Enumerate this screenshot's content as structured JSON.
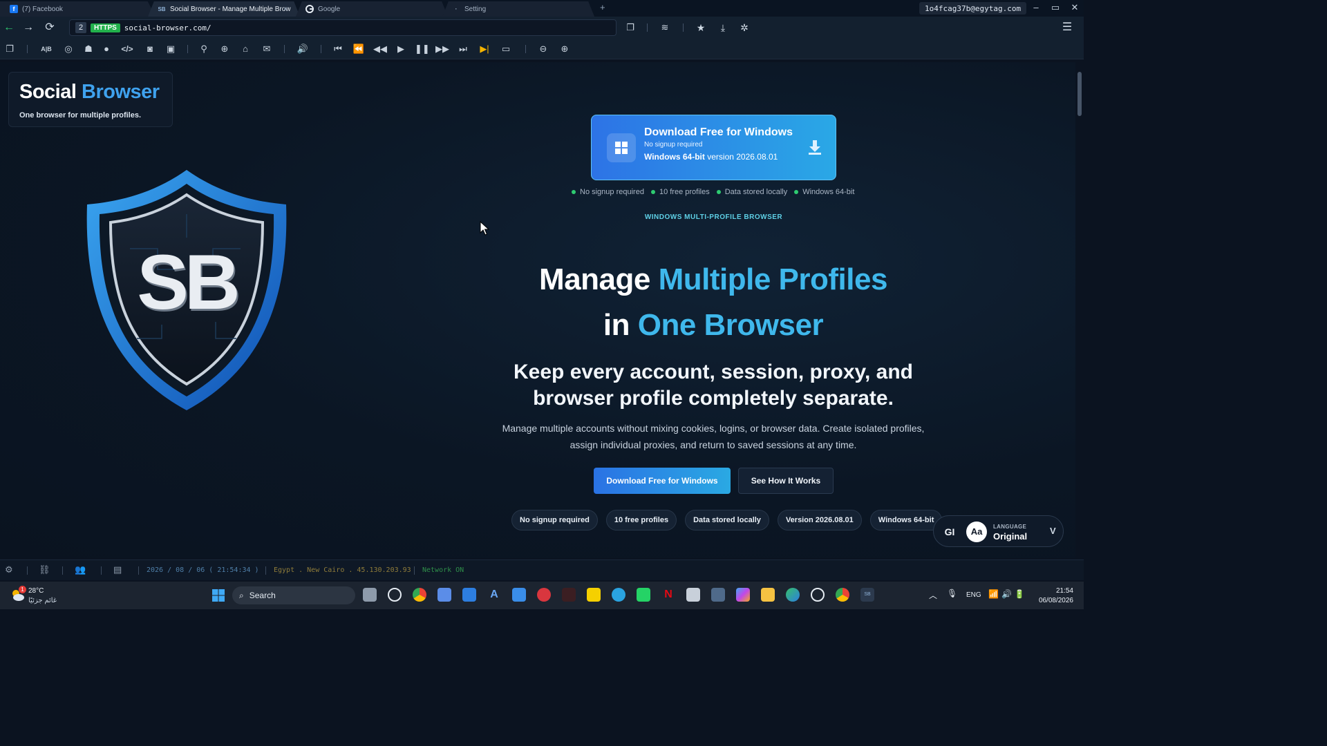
{
  "tabs": [
    {
      "label": "(7) Facebook",
      "icon": "facebook-icon",
      "active": false
    },
    {
      "label": "Social Browser - Manage Multiple Brow",
      "icon": "social-browser-icon",
      "active": true
    },
    {
      "label": "Google",
      "icon": "google-icon",
      "active": false
    },
    {
      "label": "Setting",
      "icon": "setting-icon",
      "active": false
    }
  ],
  "tab_close": "×",
  "new_tab": "+",
  "account": "1o4fcag37b@egytag.com",
  "window_controls": {
    "minimize": "–",
    "maximize": "▭",
    "close": "✕"
  },
  "nav": {
    "tab_count": "2",
    "https_badge": "HTTPS",
    "url": "social-browser.com/"
  },
  "page": {
    "brand": {
      "part1": "Social",
      "part2": "Browser",
      "tagline": "One browser for multiple profiles."
    },
    "download_card": {
      "title": "Download Free for Windows",
      "subtitle": "No signup required",
      "version_bold": "Windows 64-bit",
      "version_rest": "version 2026.08.01"
    },
    "checks": [
      "No signup required",
      "10 free profiles",
      "Data stored locally",
      "Windows 64-bit"
    ],
    "eyebrow": "WINDOWS MULTI-PROFILE BROWSER",
    "headline": {
      "line1_plain": "Manage",
      "line1_accent": "Multiple Profiles",
      "line2_plain": "in",
      "line2_accent": "One Browser"
    },
    "subheadline": "Keep every account, session, proxy, and browser profile completely separate.",
    "description": "Manage multiple accounts without mixing cookies, logins, or browser data. Create isolated profiles, assign individual proxies, and return to saved sessions at any time.",
    "cta_primary": "Download Free for Windows",
    "cta_secondary": "See How It Works",
    "pills": [
      "No signup required",
      "10 free profiles",
      "Data stored locally",
      "Version 2026.08.01",
      "Windows 64-bit"
    ],
    "language": {
      "gi": "GI",
      "aa": "Aa",
      "label": "LANGUAGE",
      "value": "Original",
      "chevron": "V"
    },
    "logo_text": "SB"
  },
  "status": {
    "date": "2026 / 08 / 06 ( 21:54:34 )",
    "location": "Egypt . New Cairo . 45.130.203.93",
    "network": "Network ON"
  },
  "taskbar": {
    "weather_temp": "28°C",
    "weather_desc": "غائم جزئيًا",
    "weather_badge": "1",
    "search": "Search",
    "tray_lang": "ENG",
    "time": "21:54",
    "date": "06/08/2026"
  },
  "colors": {
    "accent": "#3fa2ee",
    "cta": "#2a72e4",
    "success": "#2ecc71",
    "eyebrow": "#5ed0e6"
  }
}
